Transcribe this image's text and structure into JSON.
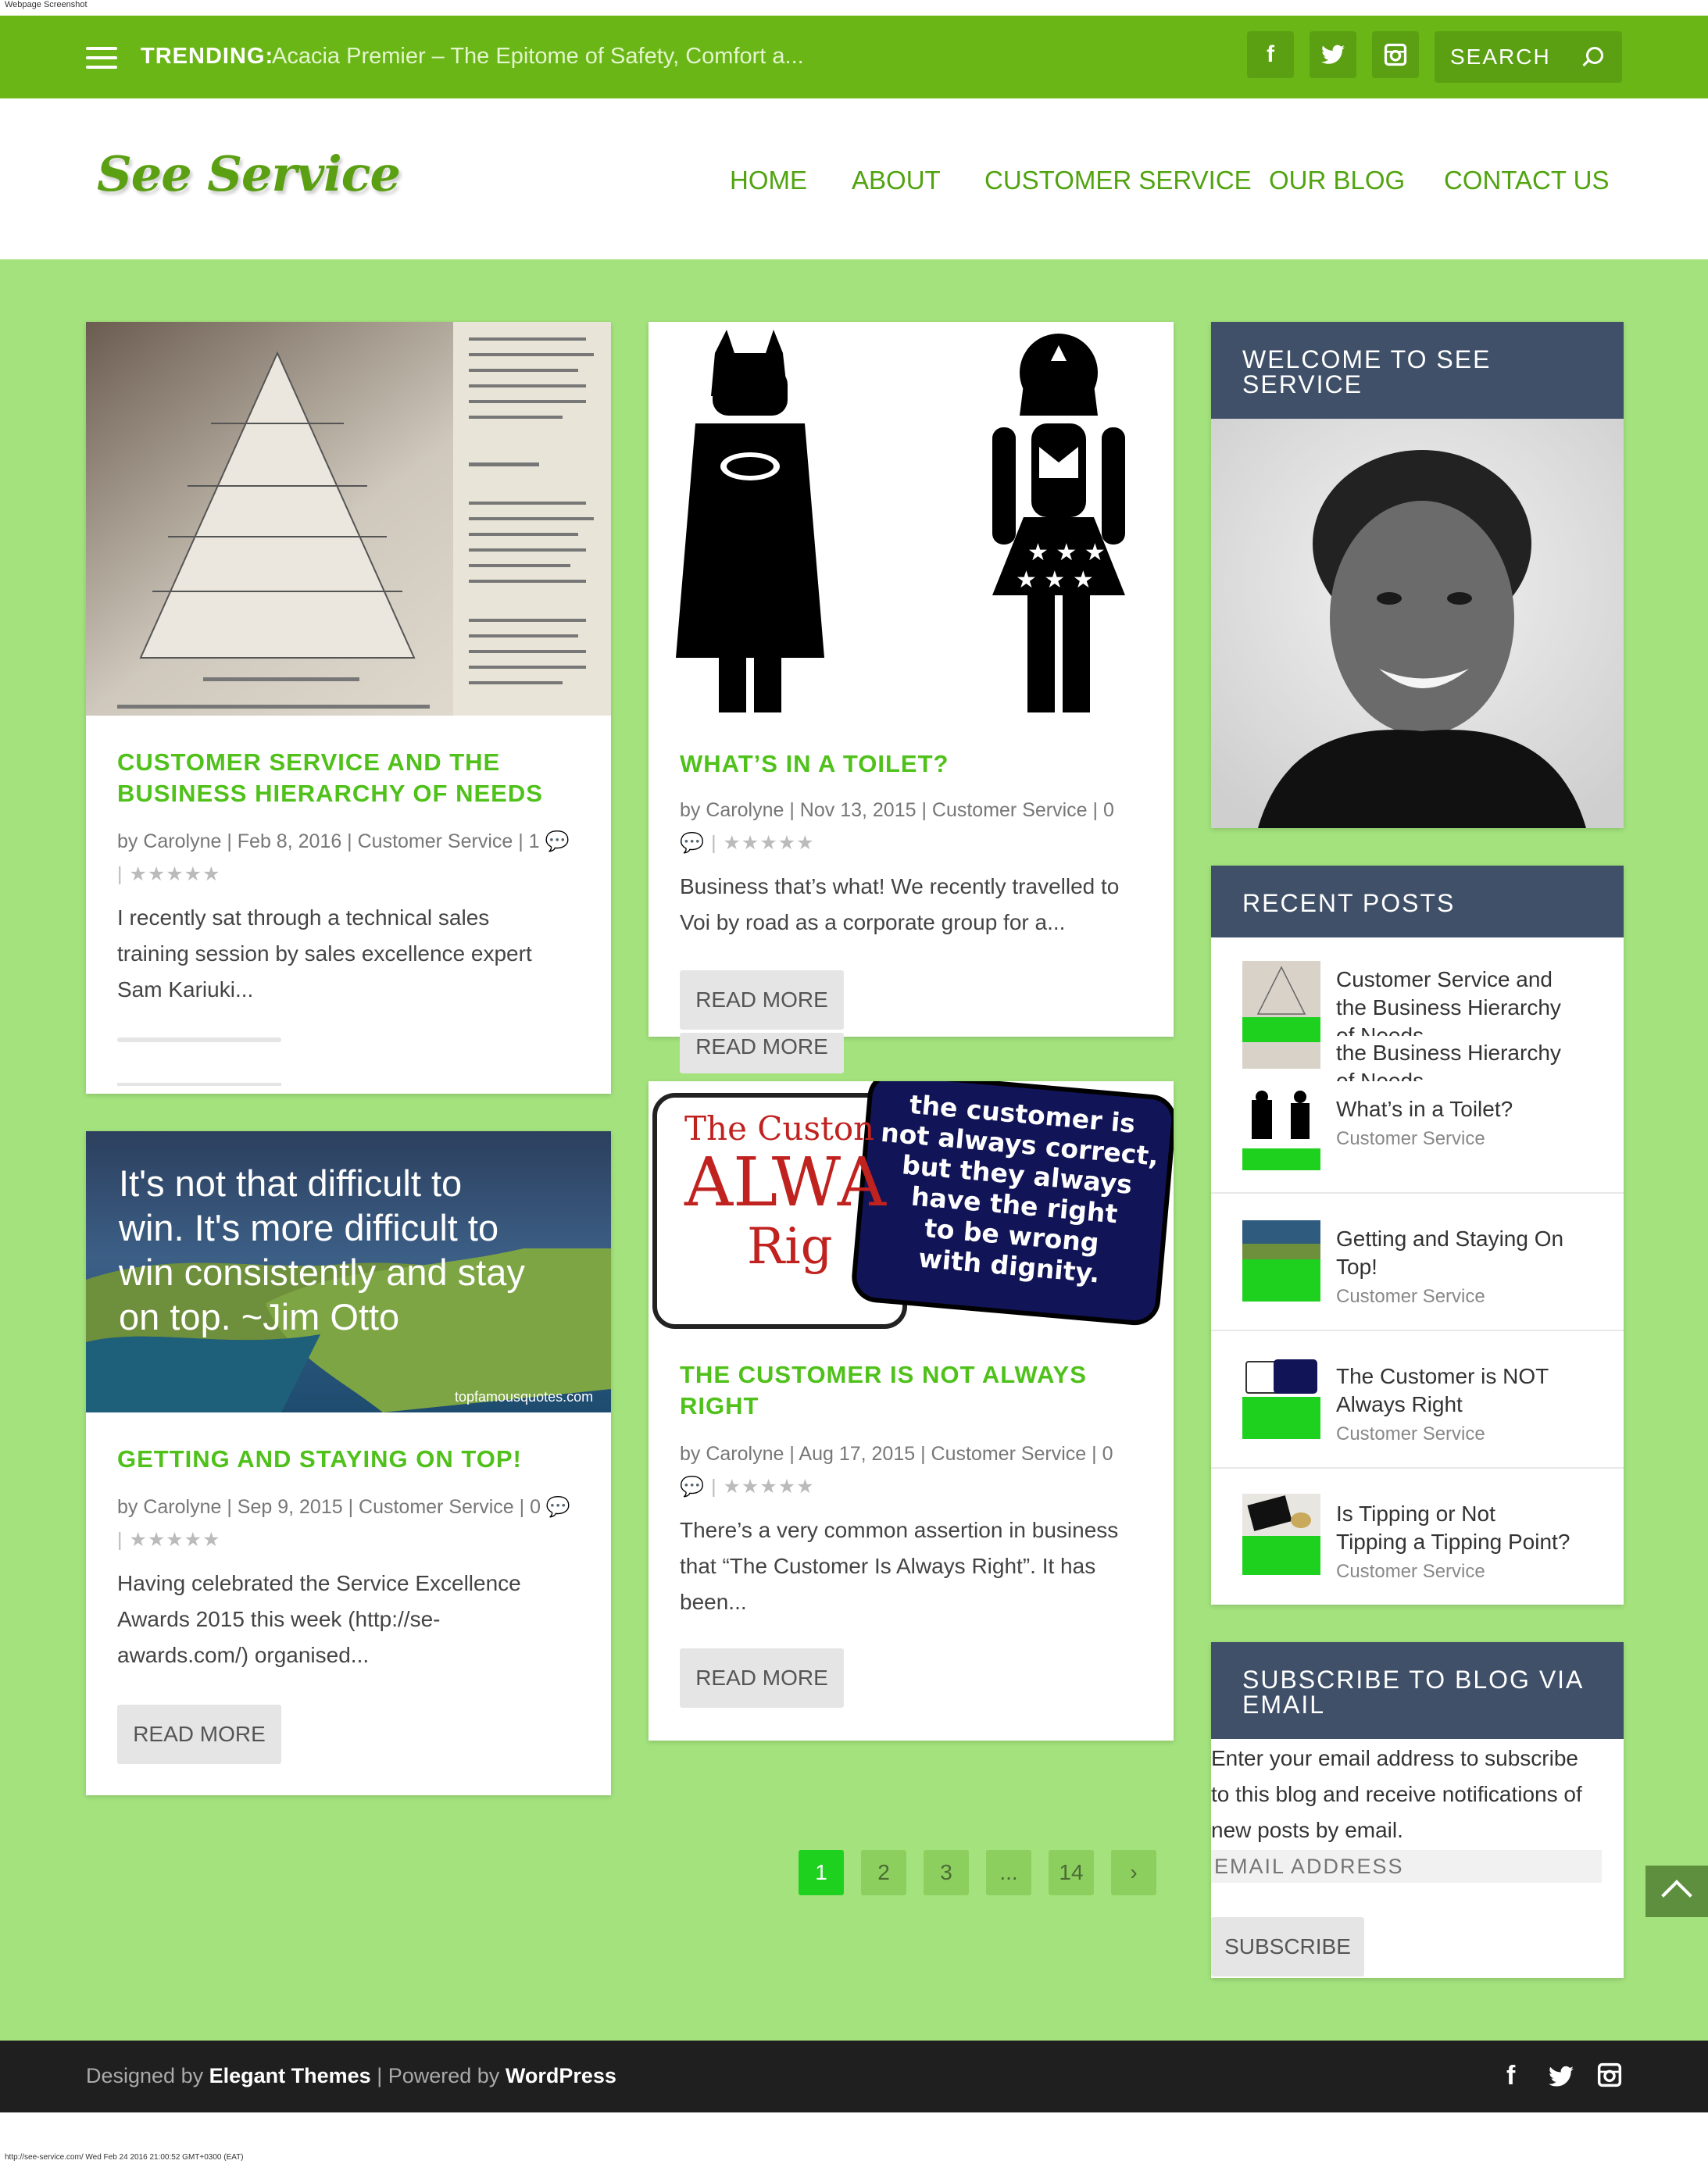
{
  "page_caption": "Webpage Screenshot",
  "bottom_caption": "http://see-service.com/ Wed Feb 24 2016 21:00:52 GMT+0300 (EAT)",
  "topbar": {
    "trending_label": "TRENDING:",
    "trending_text": "Acacia Premier – The Epitome of Safety, Comfort a...",
    "social": [
      "facebook-icon",
      "twitter-icon",
      "instagram-icon"
    ],
    "search_placeholder": "SEARCH"
  },
  "header": {
    "logo_text": "See Service",
    "nav": [
      "HOME",
      "ABOUT",
      "CUSTOMER SERVICE",
      "OUR BLOG",
      "CONTACT US"
    ]
  },
  "posts": [
    {
      "title_l1": "CUSTOMER SERVICE AND THE",
      "title_l2": "BUSINESS HIERARCHY OF NEEDS",
      "meta_l1": "by Carolyne | Feb 8, 2016 | Customer Service | 1 💬",
      "meta_l2": "| ★★★★★",
      "excerpt_l1": "I recently sat through a technical sales",
      "excerpt_l2": "training session by sales excellence expert",
      "excerpt_l3": "Sam Kariuki..."
    },
    {
      "title_l1": "WHAT’S IN A TOILET?",
      "meta_l1": "by Carolyne | Nov 13, 2015 | Customer Service | 0",
      "meta_l2": "💬 | ★★★★★",
      "excerpt_l1": "Business that’s what! We recently travelled to",
      "excerpt_l2": "Voi by road as a corporate group for a...",
      "button": "READ MORE",
      "button_ghost": "READ MORE"
    },
    {
      "title_l1": "GETTING AND STAYING ON TOP!",
      "meta_l1": "by Carolyne | Sep 9, 2015 | Customer Service | 0 💬",
      "meta_l2": "| ★★★★★",
      "excerpt_l1": "Having celebrated the Service Excellence",
      "excerpt_l2": "Awards 2015 this week (http://se-",
      "excerpt_l3": "awards.com/) organised...",
      "button": "READ MORE",
      "image_quote_l1": "It's not that difficult to",
      "image_quote_l2": "win. It's more difficult to",
      "image_quote_l3": "win consistently and stay",
      "image_quote_l4": "on top. ~Jim Otto",
      "image_credit": "topfamousquotes.com"
    },
    {
      "title_l1": "THE CUSTOMER IS NOT ALWAYS",
      "title_l2": "RIGHT",
      "meta_l1": "by Carolyne | Aug 17, 2015 | Customer Service | 0",
      "meta_l2": "💬 | ★★★★★",
      "excerpt_l1": "There’s a very common assertion in business",
      "excerpt_l2": "that “The Customer Is Always Right”. It has",
      "excerpt_l3": "been...",
      "button": "READ MORE",
      "image_sign_left_l1": "The Custon",
      "image_sign_left_l2": "ALWA",
      "image_sign_left_l3": "Rig",
      "image_sign_right_l1": "the customer is",
      "image_sign_right_l2": "not always correct,",
      "image_sign_right_l3": "but they always",
      "image_sign_right_l4": "have the right",
      "image_sign_right_l5": "to be wrong",
      "image_sign_right_l6": "with dignity."
    }
  ],
  "sidebar": {
    "welcome_l1": "WELCOME TO SEE",
    "welcome_l2": "SERVICE",
    "recent_title": "RECENT POSTS",
    "recent": [
      {
        "t1": "Customer Service and",
        "t2": "the Business Hierarchy",
        "t3": "of Needs"
      },
      {
        "t1": "the Business Hierarchy",
        "t2": "of Needs"
      },
      {
        "t1": "What’s in a Toilet?",
        "cat": "Customer Service"
      },
      {
        "t1": "Getting and Staying On",
        "t2": "Top!",
        "cat": "Customer Service"
      },
      {
        "t1": "The Customer is NOT",
        "t2": "Always Right",
        "cat": "Customer Service"
      },
      {
        "t1": "Is Tipping or Not",
        "t2": "Tipping a Tipping Point?",
        "cat": "Customer Service"
      }
    ],
    "subscribe_l1": "SUBSCRIBE TO BLOG VIA",
    "subscribe_l2": "EMAIL",
    "subscribe_text_l1": "Enter your email address to subscribe",
    "subscribe_text_l2": "to this blog and receive notifications of",
    "subscribe_text_l3": "new posts by email.",
    "email_placeholder": "EMAIL ADDRESS",
    "subscribe_button": "SUBSCRIBE"
  },
  "pagination": [
    "1",
    "2",
    "3",
    "...",
    "14",
    "›"
  ],
  "footer": {
    "designed_by": "Designed by",
    "theme": "Elegant Themes",
    "sep": "| Powered by",
    "wp": "WordPress"
  },
  "colors": {
    "topbar": "#6ab616",
    "main_bg": "#a3e27d",
    "accent": "#4fc11a",
    "widget_head": "#3f5068",
    "footer": "#1f1f1f"
  }
}
